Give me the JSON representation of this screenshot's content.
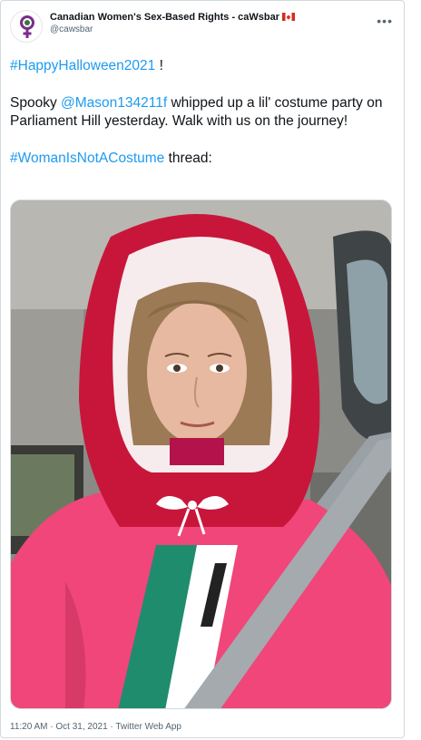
{
  "author": {
    "display_name": "Canadian Women's Sex-Based Rights - caWsbar",
    "handle": "@cawsbar",
    "flag_icon": "canada-flag-icon",
    "avatar_icon": "venus-symbol-icon"
  },
  "tweet": {
    "hashtag1": "#HappyHalloween2021",
    "hashtag1_suffix": " !",
    "p2_prefix": "Spooky ",
    "mention": "@Mason134211f",
    "p2_suffix": " whipped up a lil' costume party on Parliament Hill yesterday. Walk with us on the journey!",
    "hashtag2": "#WomanIsNotACostume",
    "hashtag2_suffix": " thread:"
  },
  "meta": {
    "timestamp": "11:20 AM · Oct 31, 2021 · Twitter Web App"
  },
  "colors": {
    "link": "#1d9bf0",
    "hood_red": "#c8163a",
    "robe_pink": "#f0467a",
    "bonnet_white": "#f6ecee"
  }
}
